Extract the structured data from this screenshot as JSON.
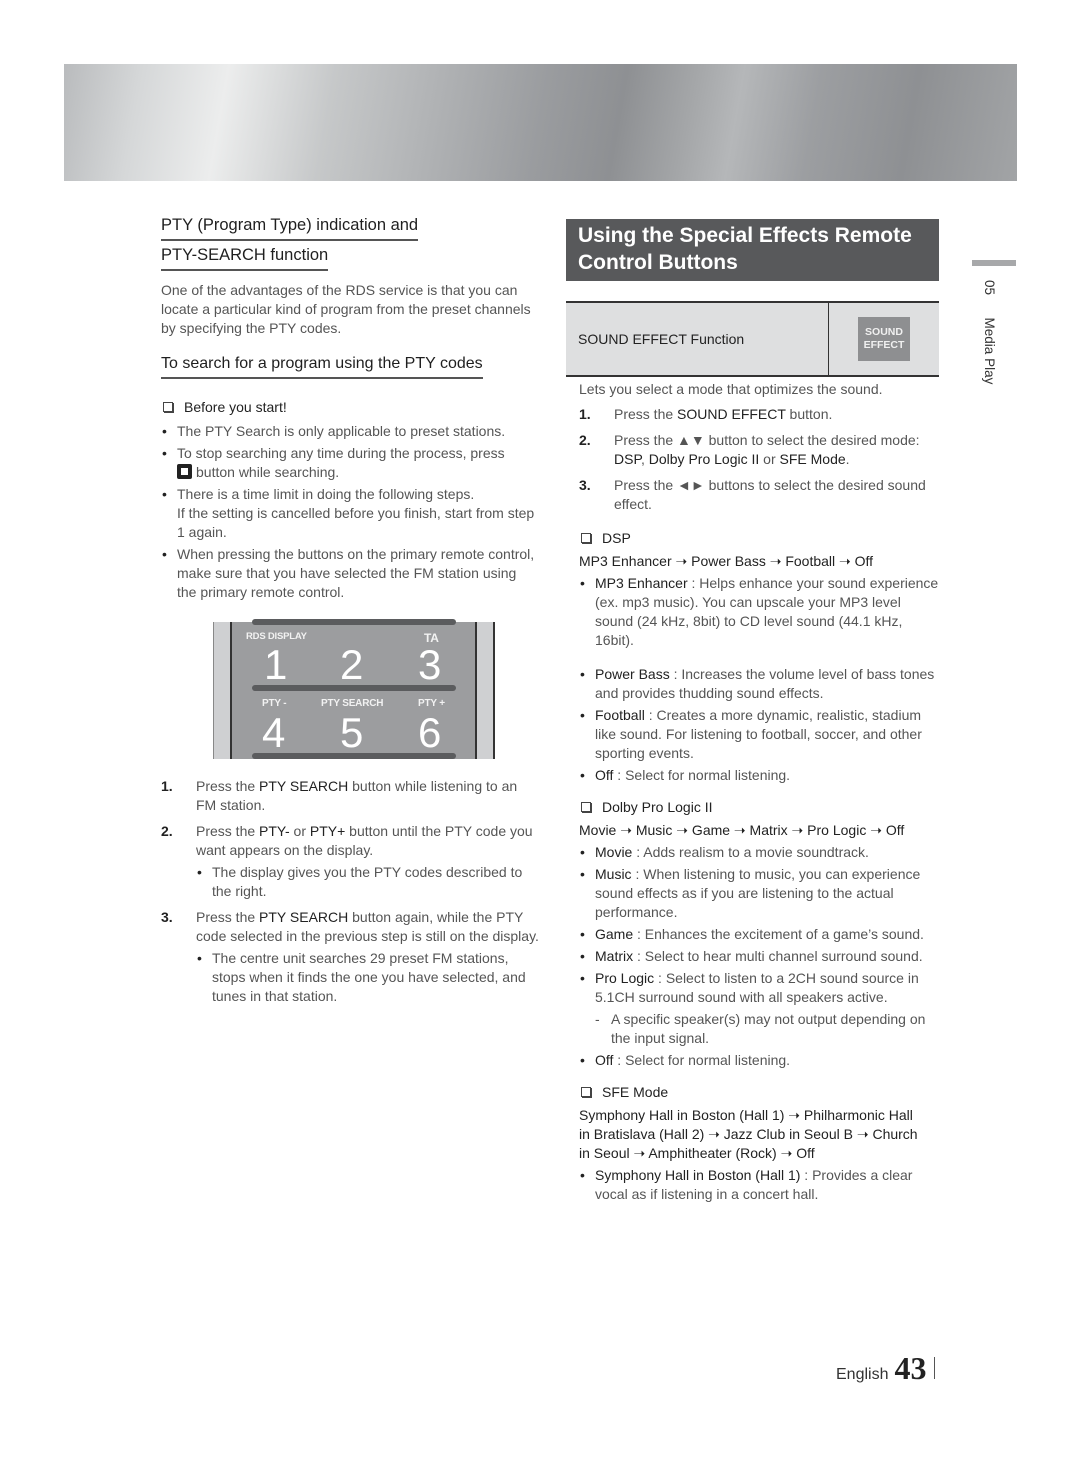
{
  "sidebar_tab": {
    "chapter": "05",
    "title": "Media Play"
  },
  "left": {
    "heading_line1": "PTY (Program Type) indication and",
    "heading_line2": "PTY-SEARCH function",
    "intro": "One of the advantages of the RDS service is that you can locate a particular kind of program from the preset channels by specifying the PTY codes.",
    "subheading": "To search for a program using the PTY codes",
    "before_start": "Before you start!",
    "notes": [
      "The PTY Search is only applicable to preset stations.",
      {
        "before": "To stop searching any time during the process, press",
        "icon": "stop-icon",
        "after": "button while searching."
      },
      {
        "line1": "There is a time limit in doing the following steps.",
        "line2": "If the setting is cancelled before you finish, start from step 1 again."
      },
      "When pressing the buttons on the primary remote control, make sure that you have selected the FM station using the primary remote control."
    ],
    "remote": {
      "labels": {
        "rds_display": "RDS DISPLAY",
        "ta": "TA",
        "pty_minus": "PTY -",
        "pty_search": "PTY SEARCH",
        "pty_plus": "PTY +"
      },
      "digits": [
        "1",
        "2",
        "3",
        "4",
        "5",
        "6"
      ]
    },
    "steps": [
      {
        "num": "1.",
        "pre": "Press the ",
        "bold": "PTY SEARCH",
        "post": " button while listening to an FM station."
      },
      {
        "num": "2.",
        "pre": "Press the ",
        "bold": "PTY-",
        "mid": " or ",
        "bold2": "PTY+",
        "post": " button until the PTY code you want appears on the display.",
        "sub": "The display gives you the PTY codes described to the right."
      },
      {
        "num": "3.",
        "pre": "Press the ",
        "bold": "PTY SEARCH",
        "post": " button again, while the PTY code selected in the previous step is still on the display.",
        "sub": "The centre unit searches 29 preset FM stations, stops when it finds the one you have selected, and tunes in that station."
      }
    ]
  },
  "right": {
    "title": "Using the Special Effects Remote Control Buttons",
    "function_label": "SOUND EFFECT Function",
    "button_line1": "SOUND",
    "button_line2": "EFFECT",
    "intro": "Lets you select a mode that optimizes the sound.",
    "steps": [
      {
        "num": "1.",
        "pre": "Press the ",
        "bold": "SOUND EFFECT",
        "post": " button."
      },
      {
        "num": "2.",
        "pre": "Press the ▲▼ button to select the desired mode: ",
        "bold": "DSP",
        "mid": ", ",
        "bold2": "Dolby Pro Logic II",
        "mid2": " or ",
        "bold3": "SFE Mode",
        "post": "."
      },
      {
        "num": "3.",
        "pre": "Press the ◄► buttons to select the desired sound effect."
      }
    ],
    "dsp": {
      "heading": "DSP",
      "flow": "MP3 Enhancer ➝ Power Bass ➝ Football ➝ Off",
      "items": [
        {
          "name": "MP3 Enhancer",
          "desc": " : Helps enhance your sound experience (ex. mp3 music). You can upscale your MP3 level sound (24 kHz, 8bit) to CD level sound (44.1 kHz, 16bit)."
        },
        {
          "name": "Power Bass",
          "desc": " : Increases the volume level of bass tones and provides thudding sound effects."
        },
        {
          "name": "Football",
          "desc": " : Creates a more dynamic, realistic, stadium like sound. For listening to football, soccer, and other sporting events."
        },
        {
          "name": "Off",
          "desc": " : Select for normal listening."
        }
      ]
    },
    "dolby": {
      "heading": "Dolby Pro Logic II",
      "flow": "Movie ➝ Music ➝ Game ➝ Matrix ➝ Pro Logic ➝ Off",
      "items": [
        {
          "name": "Movie",
          "desc": " : Adds realism to a movie soundtrack."
        },
        {
          "name": "Music",
          "desc": " : When listening to music, you can experience sound effects as if you are listening to the actual performance."
        },
        {
          "name": "Game",
          "desc": " : Enhances the excitement of a game’s sound."
        },
        {
          "name": "Matrix",
          "desc": " : Select to hear multi channel surround sound."
        },
        {
          "name": "Pro Logic",
          "desc": " : Select to listen to a 2CH sound source in 5.1CH surround sound with all speakers active.",
          "sub": "A specific speaker(s) may not output depending on the input signal."
        },
        {
          "name": "Off",
          "desc": " : Select for normal listening."
        }
      ]
    },
    "sfe": {
      "heading": "SFE Mode",
      "flow": "Symphony Hall in Boston (Hall 1) ➝ Philharmonic Hall in Bratislava (Hall 2) ➝ Jazz Club in Seoul B ➝ Church in Seoul ➝ Amphitheater (Rock) ➝ Off",
      "items": [
        {
          "name": "Symphony Hall in Boston (Hall 1)",
          "desc": " : Provides a clear vocal as if listening in a concert hall."
        }
      ]
    }
  },
  "footer": {
    "language": "English",
    "page": "43"
  }
}
